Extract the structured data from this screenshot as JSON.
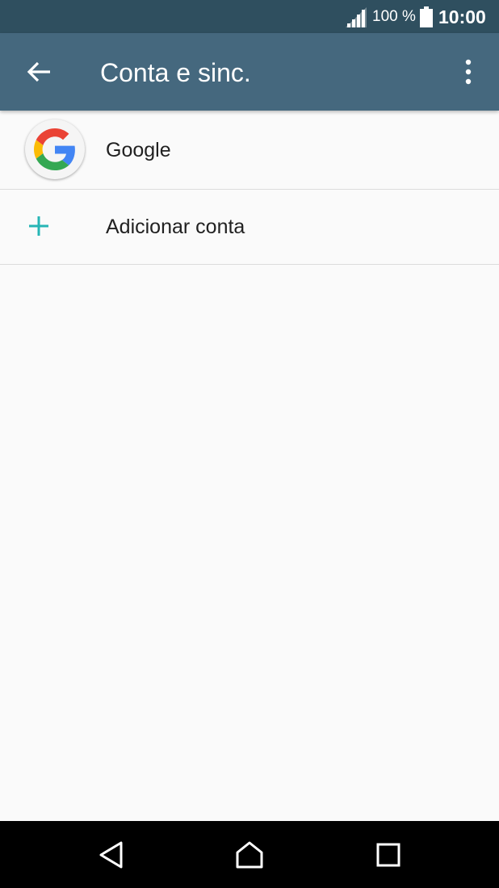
{
  "status_bar": {
    "battery_text": "100 %",
    "time": "10:00",
    "icons": [
      "signal-icon",
      "battery-icon"
    ]
  },
  "app_bar": {
    "title": "Conta e sinc.",
    "icons": [
      "back-arrow-icon",
      "more-vert-icon"
    ],
    "color": "#45687e"
  },
  "accounts": [
    {
      "label": "Google",
      "icon": "google-logo-icon"
    },
    {
      "label": "Adicionar conta",
      "icon": "plus-icon"
    }
  ],
  "nav_bar": {
    "icons": [
      "nav-back-icon",
      "nav-home-icon",
      "nav-recents-icon"
    ]
  },
  "colors": {
    "status_bar": "#2f4f5f",
    "accent": "#26b5b5",
    "background": "#fafafa"
  }
}
